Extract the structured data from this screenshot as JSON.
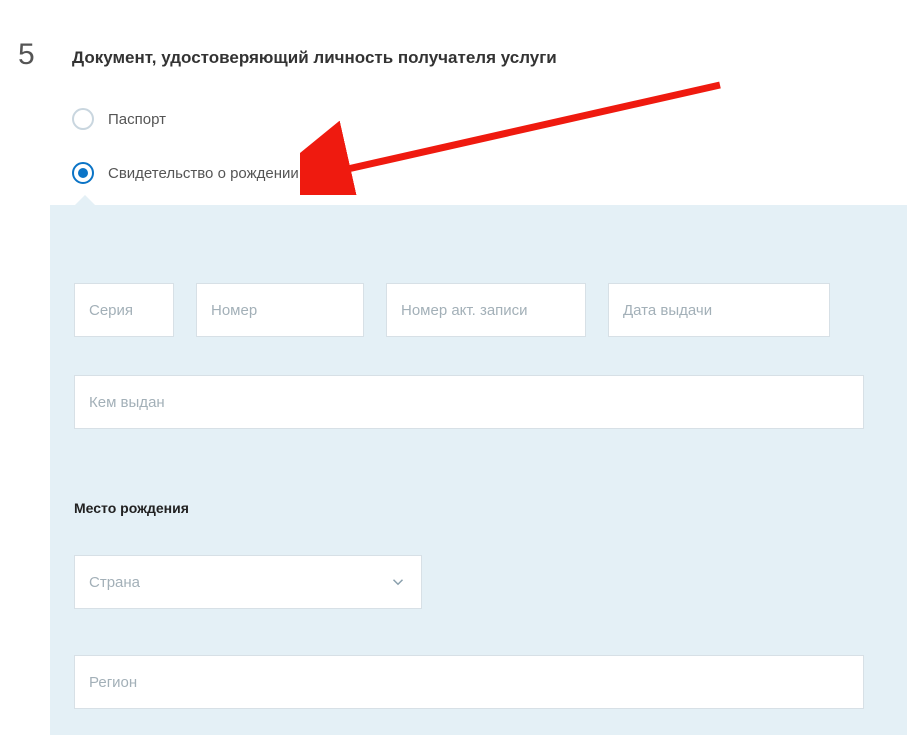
{
  "step": {
    "number": "5",
    "title": "Документ, удостоверяющий личность получателя услуги"
  },
  "radios": {
    "passport_label": "Паспорт",
    "birth_cert_label": "Свидетельство о рождении"
  },
  "form": {
    "series_placeholder": "Серия",
    "number_placeholder": "Номер",
    "act_number_placeholder": "Номер акт. записи",
    "issue_date_placeholder": "Дата выдачи",
    "issued_by_placeholder": "Кем выдан",
    "birthplace_heading": "Место рождения",
    "country_placeholder": "Страна",
    "region_placeholder": "Регион"
  }
}
